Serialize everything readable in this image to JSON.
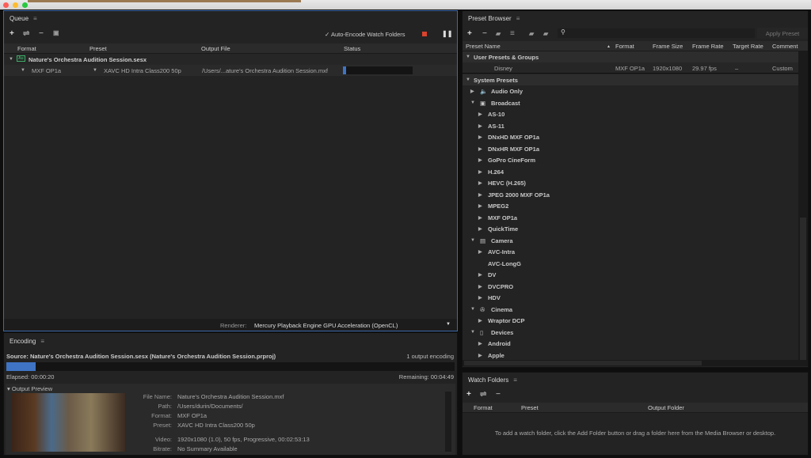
{
  "colors": {
    "accent": "#3d6aa8",
    "progress": "#3f74c4",
    "stop": "#d9432d"
  },
  "queue": {
    "title": "Queue",
    "auto_encode_label": "Auto-Encode Watch Folders",
    "auto_encode_checked": true,
    "columns": [
      "Format",
      "Preset",
      "Output File",
      "Status"
    ],
    "group": {
      "name": "Nature's Orchestra Audition Session.sesx",
      "icon": "audition-icon"
    },
    "item": {
      "format": "MXF OP1a",
      "preset": "XAVC HD Intra Class200 50p",
      "output": "/Users/...ature's Orchestra Audition Session.mxf",
      "progress": 0.05
    },
    "renderer_label": "Renderer:",
    "renderer_value": "Mercury Playback Engine GPU Acceleration (OpenCL)"
  },
  "encoding": {
    "title": "Encoding",
    "source": "Source: Nature's Orchestra Audition Session.sesx (Nature's Orchestra Audition Session.prproj)",
    "outputs": "1 output encoding",
    "progress": 0.065,
    "elapsed": "Elapsed: 00:00:20",
    "remaining": "Remaining: 00:04:49",
    "preview_label": "Output Preview",
    "details": [
      {
        "k": "File Name:",
        "v": "Nature's Orchestra Audition Session.mxf"
      },
      {
        "k": "Path:",
        "v": "/Users/durin/Documents/"
      },
      {
        "k": "Format:",
        "v": "MXF OP1a"
      },
      {
        "k": "Preset:",
        "v": "XAVC HD Intra Class200 50p"
      },
      {
        "k": "Video:",
        "v": "1920x1080 (1.0), 50 fps, Progressive, 00:02:53:13"
      },
      {
        "k": "Bitrate:",
        "v": "No Summary Available"
      }
    ]
  },
  "preset_browser": {
    "title": "Preset Browser",
    "apply_label": "Apply Preset",
    "search_placeholder": "",
    "columns": [
      "Preset Name",
      "Format",
      "Frame Size",
      "Frame Rate",
      "Target Rate",
      "Comment"
    ],
    "user_group": "User Presets & Groups",
    "user_preset": {
      "name": "Disney",
      "format": "MXF OP1a",
      "frame_size": "1920x1080",
      "frame_rate": "29.97 fps",
      "target_rate": "–",
      "comment": "Custom"
    },
    "system_group": "System Presets",
    "tree": [
      {
        "label": "Audio Only",
        "level": 1,
        "state": "collapsed",
        "icon": "speaker-icon"
      },
      {
        "label": "Broadcast",
        "level": 1,
        "state": "expanded",
        "icon": "tv-icon"
      },
      {
        "label": "AS-10",
        "level": 2,
        "state": "collapsed"
      },
      {
        "label": "AS-11",
        "level": 2,
        "state": "collapsed"
      },
      {
        "label": "DNxHD MXF OP1a",
        "level": 2,
        "state": "collapsed"
      },
      {
        "label": "DNxHR MXF OP1a",
        "level": 2,
        "state": "collapsed"
      },
      {
        "label": "GoPro CineForm",
        "level": 2,
        "state": "collapsed"
      },
      {
        "label": "H.264",
        "level": 2,
        "state": "collapsed"
      },
      {
        "label": "HEVC (H.265)",
        "level": 2,
        "state": "collapsed"
      },
      {
        "label": "JPEG 2000 MXF OP1a",
        "level": 2,
        "state": "collapsed"
      },
      {
        "label": "MPEG2",
        "level": 2,
        "state": "collapsed"
      },
      {
        "label": "MXF OP1a",
        "level": 2,
        "state": "collapsed"
      },
      {
        "label": "QuickTime",
        "level": 2,
        "state": "collapsed"
      },
      {
        "label": "Camera",
        "level": 1,
        "state": "expanded",
        "icon": "camera-icon"
      },
      {
        "label": "AVC-Intra",
        "level": 2,
        "state": "collapsed"
      },
      {
        "label": "AVC-LongG",
        "level": 2,
        "state": "leaf"
      },
      {
        "label": "DV",
        "level": 2,
        "state": "collapsed"
      },
      {
        "label": "DVCPRO",
        "level": 2,
        "state": "collapsed"
      },
      {
        "label": "HDV",
        "level": 2,
        "state": "collapsed"
      },
      {
        "label": "Cinema",
        "level": 1,
        "state": "expanded",
        "icon": "film-reel-icon"
      },
      {
        "label": "Wraptor DCP",
        "level": 2,
        "state": "collapsed"
      },
      {
        "label": "Devices",
        "level": 1,
        "state": "expanded",
        "icon": "phone-icon"
      },
      {
        "label": "Android",
        "level": 2,
        "state": "collapsed"
      },
      {
        "label": "Apple",
        "level": 2,
        "state": "collapsed"
      }
    ]
  },
  "watch_folders": {
    "title": "Watch Folders",
    "columns": [
      "Format",
      "Preset",
      "Output Folder"
    ],
    "empty_message": "To add a watch folder, click the Add Folder button or drag a folder here from the Media Browser or desktop."
  }
}
